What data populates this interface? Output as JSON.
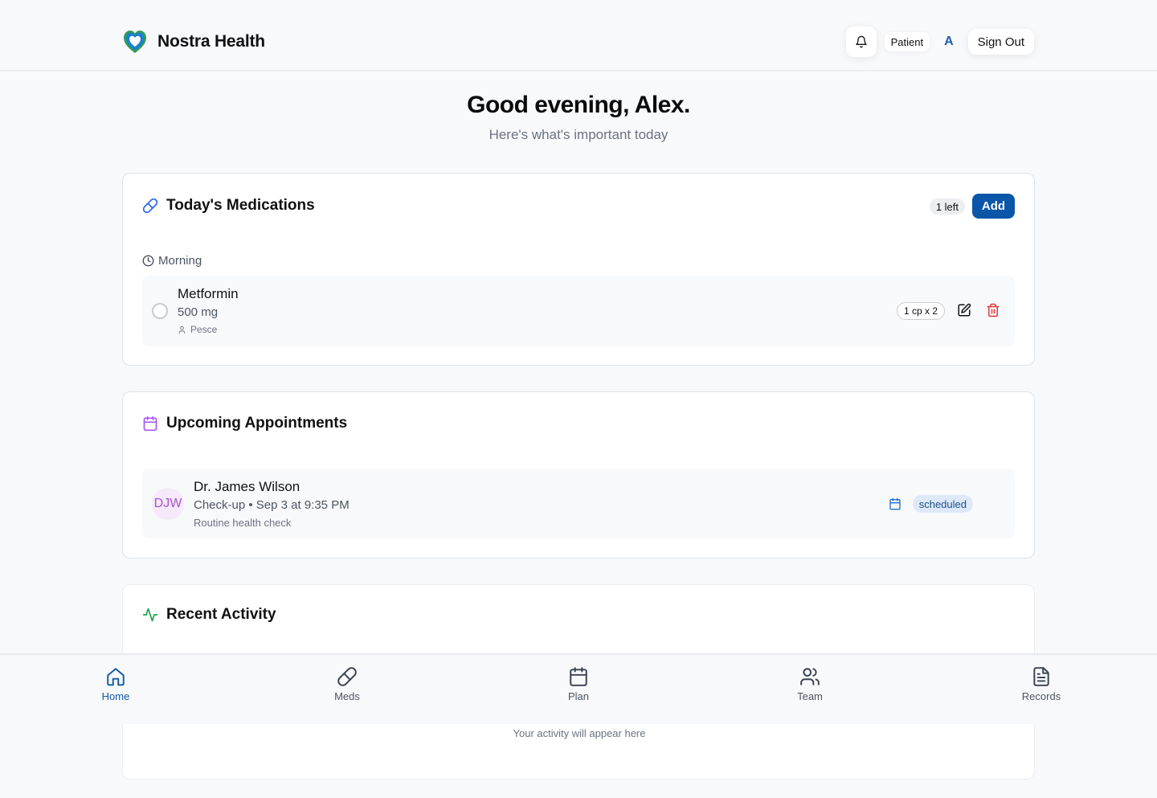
{
  "app": {
    "name": "Nostra Health"
  },
  "header": {
    "role": "Patient",
    "avatar_letter": "A",
    "sign_out": "Sign Out"
  },
  "greeting": {
    "title": "Good evening, Alex.",
    "subtitle": "Here's what's important today"
  },
  "medications": {
    "title": "Today's Medications",
    "remaining": "1 left",
    "add_label": "Add",
    "section": "Morning",
    "items": [
      {
        "name": "Metformin",
        "dose": "500 mg",
        "added_by": "Pesce",
        "schedule": "1 cp x 2"
      }
    ]
  },
  "appointments": {
    "title": "Upcoming Appointments",
    "items": [
      {
        "initials": "DJW",
        "doctor": "Dr. James Wilson",
        "details": "Check-up • Sep 3 at 9:35 PM",
        "note": "Routine health check",
        "status": "scheduled"
      }
    ]
  },
  "activity": {
    "title": "Recent Activity",
    "empty_hint": "Your activity will appear here"
  },
  "nav": {
    "items": [
      {
        "label": "Home",
        "icon": "home-icon",
        "active": true
      },
      {
        "label": "Meds",
        "icon": "pill-icon",
        "active": false
      },
      {
        "label": "Plan",
        "icon": "calendar-icon",
        "active": false
      },
      {
        "label": "Team",
        "icon": "users-icon",
        "active": false
      },
      {
        "label": "Records",
        "icon": "document-icon",
        "active": false
      }
    ]
  },
  "colors": {
    "primary": "#0a56a8",
    "nav_active": "#1259a8",
    "delete": "#e53935",
    "appointments_accent": "#a855f7",
    "activity_accent": "#16a34a",
    "medications_accent": "#2563eb"
  }
}
